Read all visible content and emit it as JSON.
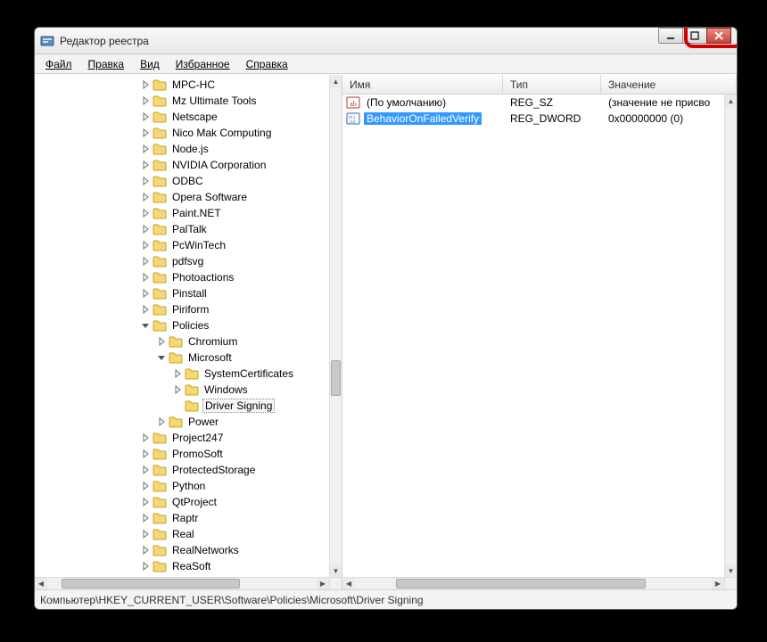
{
  "window": {
    "title": "Редактор реестра"
  },
  "menu": {
    "file": "Файл",
    "edit": "Правка",
    "view": "Вид",
    "favorites": "Избранное",
    "help": "Справка"
  },
  "tree": [
    {
      "depth": 4,
      "exp": "closed",
      "label": "MPC-HC"
    },
    {
      "depth": 4,
      "exp": "closed",
      "label": "Mz Ultimate Tools"
    },
    {
      "depth": 4,
      "exp": "closed",
      "label": "Netscape"
    },
    {
      "depth": 4,
      "exp": "closed",
      "label": "Nico Mak Computing"
    },
    {
      "depth": 4,
      "exp": "closed",
      "label": "Node.js"
    },
    {
      "depth": 4,
      "exp": "closed",
      "label": "NVIDIA Corporation"
    },
    {
      "depth": 4,
      "exp": "closed",
      "label": "ODBC"
    },
    {
      "depth": 4,
      "exp": "closed",
      "label": "Opera Software"
    },
    {
      "depth": 4,
      "exp": "closed",
      "label": "Paint.NET"
    },
    {
      "depth": 4,
      "exp": "closed",
      "label": "PalTalk"
    },
    {
      "depth": 4,
      "exp": "closed",
      "label": "PcWinTech"
    },
    {
      "depth": 4,
      "exp": "closed",
      "label": "pdfsvg"
    },
    {
      "depth": 4,
      "exp": "closed",
      "label": "Photoactions"
    },
    {
      "depth": 4,
      "exp": "closed",
      "label": "Pinstall"
    },
    {
      "depth": 4,
      "exp": "closed",
      "label": "Piriform"
    },
    {
      "depth": 4,
      "exp": "open",
      "label": "Policies"
    },
    {
      "depth": 5,
      "exp": "closed",
      "label": "Chromium"
    },
    {
      "depth": 5,
      "exp": "open",
      "label": "Microsoft"
    },
    {
      "depth": 6,
      "exp": "closed",
      "label": "SystemCertificates"
    },
    {
      "depth": 6,
      "exp": "closed",
      "label": "Windows"
    },
    {
      "depth": 6,
      "exp": "none",
      "label": "Driver Signing",
      "boxed": true
    },
    {
      "depth": 5,
      "exp": "closed",
      "label": "Power"
    },
    {
      "depth": 4,
      "exp": "closed",
      "label": "Project247"
    },
    {
      "depth": 4,
      "exp": "closed",
      "label": "PromoSoft"
    },
    {
      "depth": 4,
      "exp": "closed",
      "label": "ProtectedStorage"
    },
    {
      "depth": 4,
      "exp": "closed",
      "label": "Python"
    },
    {
      "depth": 4,
      "exp": "closed",
      "label": "QtProject"
    },
    {
      "depth": 4,
      "exp": "closed",
      "label": "Raptr"
    },
    {
      "depth": 4,
      "exp": "closed",
      "label": "Real"
    },
    {
      "depth": 4,
      "exp": "closed",
      "label": "RealNetworks"
    },
    {
      "depth": 4,
      "exp": "closed",
      "label": "ReaSoft"
    }
  ],
  "columns": {
    "name": "Имя",
    "type": "Тип",
    "value": "Значение"
  },
  "values": [
    {
      "icon": "str",
      "name": "(По умолчанию)",
      "type": "REG_SZ",
      "value": "(значение не присво",
      "selected": false
    },
    {
      "icon": "bin",
      "name": "BehaviorOnFailedVerify",
      "type": "REG_DWORD",
      "value": "0x00000000 (0)",
      "selected": true
    }
  ],
  "status": "Компьютер\\HKEY_CURRENT_USER\\Software\\Policies\\Microsoft\\Driver Signing"
}
